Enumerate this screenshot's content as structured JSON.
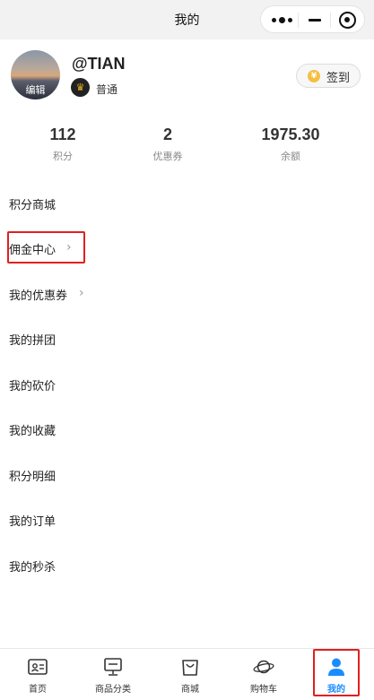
{
  "header": {
    "title": "我的"
  },
  "profile": {
    "avatar_edit_label": "编辑",
    "username": "@TIAN",
    "level": "普通",
    "signin_label": "签到"
  },
  "stats": [
    {
      "value": "112",
      "label": "积分"
    },
    {
      "value": "2",
      "label": "优惠券"
    },
    {
      "value": "1975.30",
      "label": "余额"
    }
  ],
  "menu": [
    {
      "label": "积分商城"
    },
    {
      "label": "佣金中心"
    },
    {
      "label": "我的优惠券"
    },
    {
      "label": "我的拼团"
    },
    {
      "label": "我的砍价"
    },
    {
      "label": "我的收藏"
    },
    {
      "label": "积分明细"
    },
    {
      "label": "我的订单"
    },
    {
      "label": "我的秒杀"
    }
  ],
  "tabbar": [
    {
      "label": "首页",
      "icon": "home-card-icon"
    },
    {
      "label": "商品分类",
      "icon": "category-icon"
    },
    {
      "label": "商城",
      "icon": "shopping-bag-icon"
    },
    {
      "label": "购物车",
      "icon": "planet-icon"
    },
    {
      "label": "我的",
      "icon": "user-icon"
    }
  ],
  "colors": {
    "accent": "#1a8cff",
    "highlight": "#e0201e",
    "gold": "#f4c042"
  }
}
